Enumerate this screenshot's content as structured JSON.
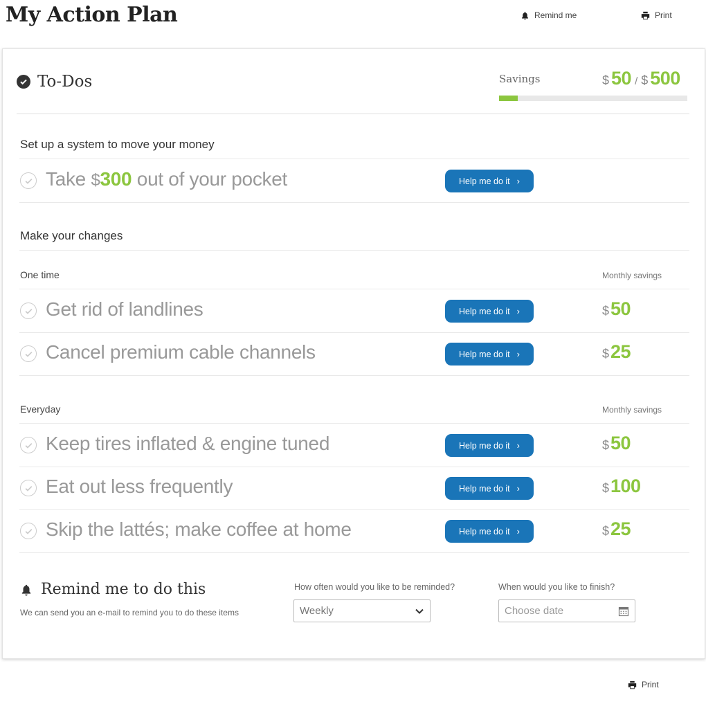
{
  "header": {
    "title": "My Action Plan",
    "remind_label": "Remind me",
    "print_label": "Print"
  },
  "todos": {
    "title": "To-Dos",
    "savings_label": "Savings",
    "currency": "$",
    "saved": "50",
    "goal": "500",
    "progress_fraction": 0.1,
    "accent_color": "#8cc63f",
    "button_color": "#1a75b8"
  },
  "system_section": {
    "heading": "Set up a system to move your money",
    "task": {
      "text_before": "Take ",
      "currency": "$",
      "amount": "300",
      "text_after": " out of your pocket",
      "button": "Help me do it"
    }
  },
  "changes": {
    "heading": "Make your changes",
    "groups": [
      {
        "label": "One time",
        "savings_label": "Monthly savings",
        "items": [
          {
            "text": "Get rid of landlines",
            "button": "Help me do it",
            "currency": "$",
            "amount": "50"
          },
          {
            "text": "Cancel premium cable channels",
            "button": "Help me do it",
            "currency": "$",
            "amount": "25"
          }
        ]
      },
      {
        "label": "Everyday",
        "savings_label": "Monthly savings",
        "items": [
          {
            "text": "Keep tires inflated & engine tuned",
            "button": "Help me do it",
            "currency": "$",
            "amount": "50"
          },
          {
            "text": "Eat out less frequently",
            "button": "Help me do it",
            "currency": "$",
            "amount": "100"
          },
          {
            "text": "Skip the lattés; make coffee at home",
            "button": "Help me do it",
            "currency": "$",
            "amount": "25"
          }
        ]
      }
    ]
  },
  "reminder": {
    "title": "Remind me to do this",
    "description": "We can send you an e-mail to remind you to do these items",
    "frequency_label": "How often would you like to be reminded?",
    "frequency_value": "Weekly",
    "finish_label": "When would you like to finish?",
    "finish_placeholder": "Choose date"
  },
  "footer": {
    "print_label": "Print"
  },
  "icons": {
    "bell": "bell-icon",
    "printer": "printer-icon",
    "check": "check-circle-icon",
    "chevron_right": "chevron-right-icon",
    "chevron_down": "chevron-down-icon",
    "calendar": "calendar-icon"
  }
}
